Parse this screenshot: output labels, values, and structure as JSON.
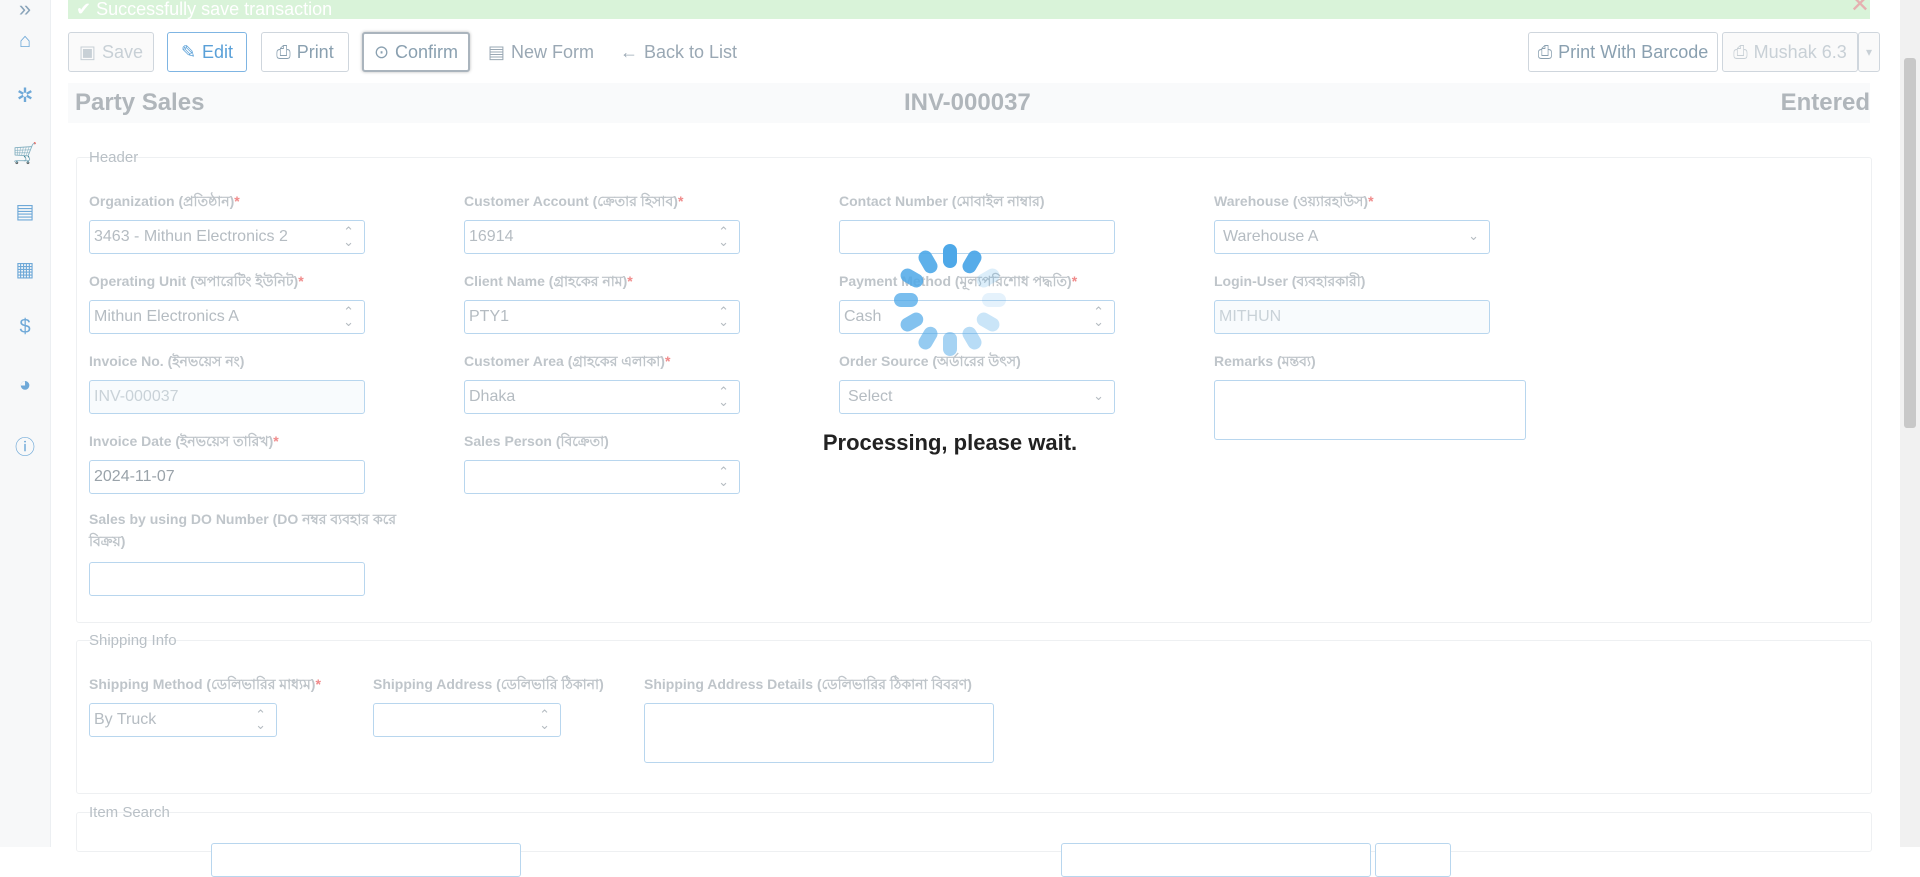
{
  "sidebar": {
    "toggle_icon": "»",
    "items": [
      {
        "icon": "home-icon",
        "glyph": "⌂"
      },
      {
        "icon": "gear-icon",
        "glyph": "✲"
      },
      {
        "icon": "cart-icon",
        "glyph": "🛒"
      },
      {
        "icon": "warehouse-icon",
        "glyph": "▤"
      },
      {
        "icon": "document-icon",
        "glyph": "▦"
      },
      {
        "icon": "dollar-icon",
        "glyph": "$"
      },
      {
        "icon": "pie-chart-icon",
        "glyph": "◕"
      },
      {
        "icon": "info-icon",
        "glyph": "ⓘ"
      }
    ]
  },
  "alert": {
    "message": "✔ Successfully save transaction",
    "close": "✕"
  },
  "toolbar": {
    "save": "Save",
    "edit": "Edit",
    "print": "Print",
    "confirm": "Confirm",
    "new_form": "New Form",
    "back_to_list": "Back to List",
    "print_with_barcode": "Print With Barcode",
    "mushak": "Mushak 6.3"
  },
  "title": {
    "left": "Party Sales",
    "center": "INV-000037",
    "right": "Entered"
  },
  "header": {
    "title": "Header",
    "organization": {
      "label": "Organization (প্রতিষ্ঠান)",
      "value": "3463 - Mithun Electronics 2"
    },
    "customer_account": {
      "label": "Customer Account (ক্রেতার হিসাব)",
      "value": "16914"
    },
    "contact_number": {
      "label": "Contact Number (মোবাইল নাম্বার)",
      "value": ""
    },
    "warehouse": {
      "label": "Warehouse (ওয়্যারহাউস)",
      "value": "Warehouse A"
    },
    "operating_unit": {
      "label": "Operating Unit (অপারেটিং ইউনিট)",
      "value": "Mithun Electronics A"
    },
    "client_name": {
      "label": "Client Name (গ্রাহকের নাম)",
      "value": "PTY1"
    },
    "payment_method": {
      "label": "Payment Method (মূল্যপরিশোধ পদ্ধতি)",
      "value": "Cash"
    },
    "login_user": {
      "label": "Login-User (ব্যবহারকারী)",
      "value": "MITHUN"
    },
    "invoice_no": {
      "label": "Invoice No. (ইনভয়েস নং)",
      "value": "INV-000037"
    },
    "customer_area": {
      "label": "Customer Area (গ্রাহকের এলাকা)",
      "value": "Dhaka"
    },
    "order_source": {
      "label": "Order Source (অর্ডারের উৎস)",
      "value": "Select"
    },
    "remarks": {
      "label": "Remarks (মন্তব্য)",
      "value": ""
    },
    "invoice_date": {
      "label": "Invoice Date (ইনভয়েস তারিখ)",
      "value": "2024-11-07"
    },
    "sales_person": {
      "label": "Sales Person (বিক্রেতা)",
      "value": ""
    },
    "do_number": {
      "label": "Sales by using DO Number (DO নম্বর ব্যবহার করে বিক্রয়)",
      "value": ""
    }
  },
  "shipping": {
    "title": "Shipping Info",
    "method": {
      "label": "Shipping Method (ডেলিভারির মাধ্যম)",
      "value": "By Truck"
    },
    "address": {
      "label": "Shipping Address (ডেলিভারি ঠিকানা)",
      "value": ""
    },
    "details": {
      "label": "Shipping Address Details (ডেলিভারির ঠিকানা বিবরণ)",
      "value": ""
    }
  },
  "item_search": {
    "title": "Item Search"
  },
  "overlay": {
    "message": "Processing, please wait."
  },
  "colors": {
    "accent": "#4ea8e8",
    "required": "#f08a8a"
  }
}
